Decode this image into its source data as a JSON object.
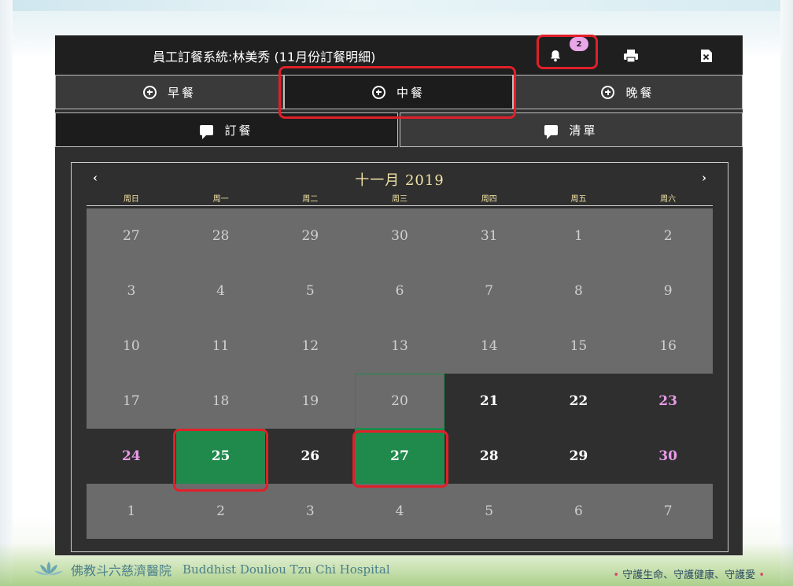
{
  "header": {
    "title": "員工訂餐系統:林美秀 (11月份訂餐明細)",
    "notification_count": "2"
  },
  "icons": {
    "bell": "bell-icon",
    "print": "printer-icon",
    "excel": "excel-export-icon",
    "meal_tab": "circle-plus-icon",
    "sub_tab": "chat-bubble-icon"
  },
  "meal_tabs": [
    {
      "label": "早餐",
      "active": false
    },
    {
      "label": "中餐",
      "active": true
    },
    {
      "label": "晚餐",
      "active": false
    }
  ],
  "sub_tabs": [
    {
      "label": "訂餐",
      "active": true
    },
    {
      "label": "清單",
      "active": false
    }
  ],
  "calendar": {
    "title": "十一月 2019",
    "prev": "‹",
    "next": "›",
    "weekdays": [
      "周日",
      "周一",
      "周二",
      "周三",
      "周四",
      "周五",
      "周六"
    ],
    "weeks": [
      [
        "27",
        "28",
        "29",
        "30",
        "31",
        "1",
        "2"
      ],
      [
        "3",
        "4",
        "5",
        "6",
        "7",
        "8",
        "9"
      ],
      [
        "10",
        "11",
        "12",
        "13",
        "14",
        "15",
        "16"
      ],
      [
        "17",
        "18",
        "19",
        "20",
        "21",
        "22",
        "23"
      ],
      [
        "24",
        "25",
        "26",
        "27",
        "28",
        "29",
        "30"
      ],
      [
        "1",
        "2",
        "3",
        "4",
        "5",
        "6",
        "7"
      ]
    ],
    "today": "20",
    "ordered_days": [
      "25",
      "27"
    ]
  },
  "footer": {
    "hospital_cn": "佛教斗六慈濟醫院",
    "hospital_en": "Buddhist  Douliou Tzu Chi Hospital",
    "slogan": "守護生命、守護健康、守護愛"
  },
  "colors": {
    "accent_green": "#1f8a4c",
    "weekend_pink": "#e99be9",
    "highlight_red": "#e0202a",
    "calendar_gold": "#f2e3a6"
  }
}
